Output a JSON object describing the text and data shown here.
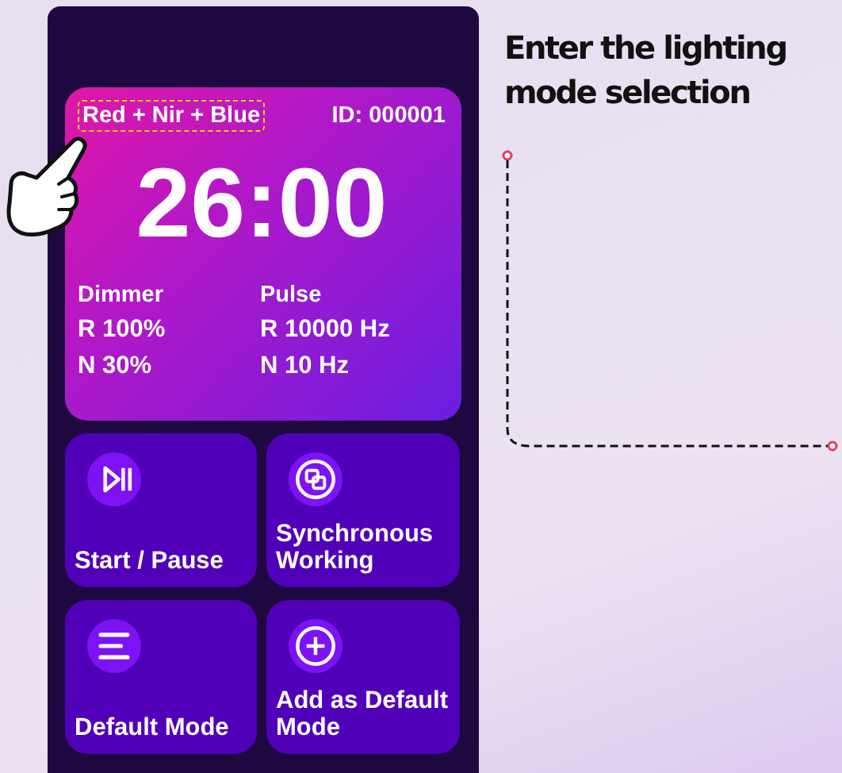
{
  "card": {
    "mode": "Red + Nir + Blue",
    "mode_highlighted": true,
    "device_id": "ID: 000001",
    "timer": "26:00",
    "columns": [
      {
        "heading": "Dimmer",
        "values": [
          "R 100%",
          "N 30%"
        ]
      },
      {
        "heading": "Pulse",
        "values": [
          "R 10000 Hz",
          "N 10 Hz"
        ]
      }
    ]
  },
  "actions": [
    {
      "kind": "play-pause",
      "label": "Start / Pause"
    },
    {
      "kind": "sync",
      "label": "Synchronous Working"
    },
    {
      "kind": "list",
      "label": "Default Mode"
    },
    {
      "kind": "plus",
      "label": "Add as Default Mode"
    }
  ],
  "callout": {
    "text": "Enter the lighting mode selection"
  }
}
